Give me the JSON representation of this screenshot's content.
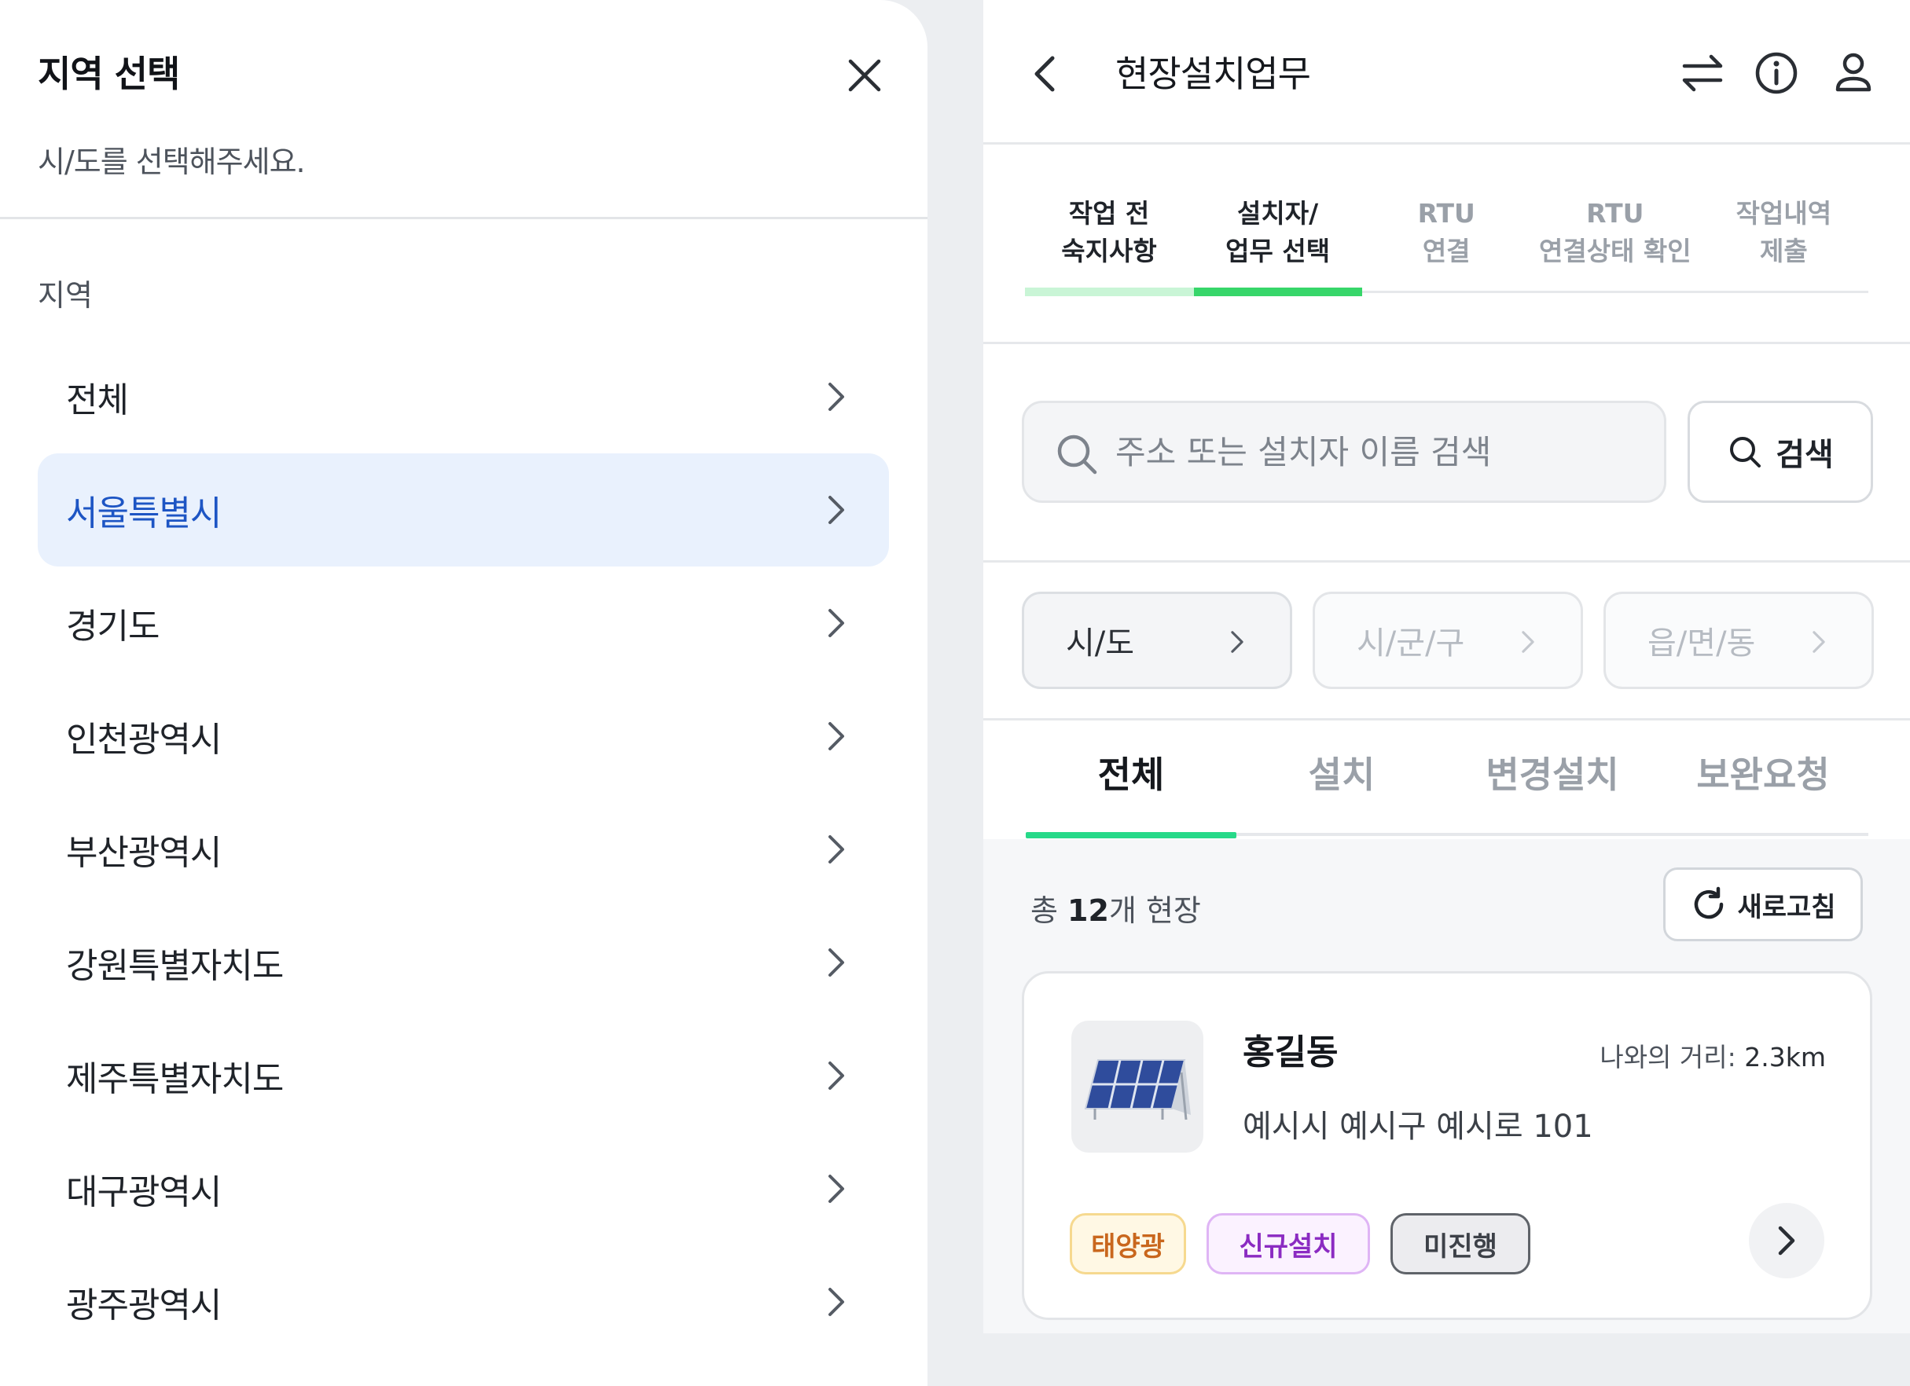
{
  "sheet": {
    "title": "지역 선택",
    "subtitle": "시/도를 선택해주세요.",
    "section_label": "지역",
    "regions": [
      {
        "label": "전체",
        "selected": false
      },
      {
        "label": "서울특별시",
        "selected": true
      },
      {
        "label": "경기도",
        "selected": false
      },
      {
        "label": "인천광역시",
        "selected": false
      },
      {
        "label": "부산광역시",
        "selected": false
      },
      {
        "label": "강원특별자치도",
        "selected": false
      },
      {
        "label": "제주특별자치도",
        "selected": false
      },
      {
        "label": "대구광역시",
        "selected": false
      },
      {
        "label": "광주광역시",
        "selected": false
      }
    ]
  },
  "header": {
    "title": "현장설치업무",
    "icons": [
      "back-icon",
      "swap-icon",
      "info-icon",
      "user-icon"
    ]
  },
  "steps": [
    {
      "line1": "작업 전",
      "line2": "숙지사항",
      "state": "done"
    },
    {
      "line1": "설치자/",
      "line2": "업무 선택",
      "state": "current"
    },
    {
      "line1": "RTU",
      "line2": "연결",
      "state": "todo"
    },
    {
      "line1": "RTU",
      "line2": "연결상태 확인",
      "state": "todo"
    },
    {
      "line1": "작업내역",
      "line2": "제출",
      "state": "todo"
    }
  ],
  "search": {
    "placeholder": "주소 또는 설치자 이름 검색",
    "value": "",
    "button_label": "검색"
  },
  "region_filter": [
    {
      "label": "시/도",
      "enabled": true
    },
    {
      "label": "시/군/구",
      "enabled": false
    },
    {
      "label": "읍/면/동",
      "enabled": false
    }
  ],
  "tabs": [
    {
      "label": "전체",
      "active": true
    },
    {
      "label": "설치",
      "active": false
    },
    {
      "label": "변경설치",
      "active": false
    },
    {
      "label": "보완요청",
      "active": false
    }
  ],
  "summary": {
    "prefix": "총 ",
    "count": "12",
    "suffix": "개 현장",
    "refresh_label": "새로고침"
  },
  "card": {
    "name": "홍길동",
    "distance_label": "나와의 거리:",
    "distance_value": "2.3km",
    "address": "예시시 예시구 예시로 101",
    "badges": [
      "태양광",
      "신규설치",
      "미진행"
    ],
    "thumbnail": "solar-panel-image"
  },
  "colors": {
    "selected_bg": "#e9f1fd",
    "selected_text": "#1d55c4",
    "progress_done": "#c9f5d6",
    "progress_current": "#37d66a",
    "tab_indicator": "#27d989",
    "badge_solar": "#c9671d",
    "badge_new": "#8b2bc2",
    "badge_pending": "#3d4148"
  }
}
